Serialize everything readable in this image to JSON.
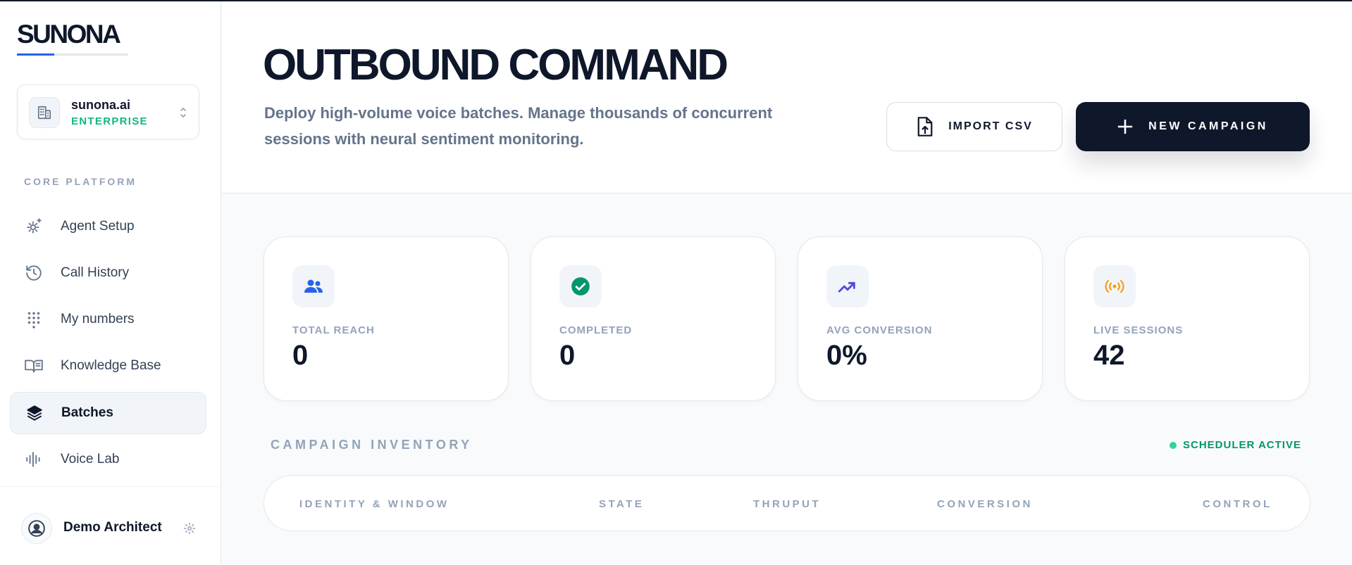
{
  "brand": {
    "name": "SUNONA"
  },
  "org": {
    "name": "sunona.ai",
    "plan": "ENTERPRISE"
  },
  "sidebar": {
    "section_title": "CORE PLATFORM",
    "items": [
      {
        "label": "Agent Setup",
        "icon": "gear-sparkle-icon"
      },
      {
        "label": "Call History",
        "icon": "history-icon"
      },
      {
        "label": "My numbers",
        "icon": "dialpad-icon"
      },
      {
        "label": "Knowledge Base",
        "icon": "book-open-icon"
      },
      {
        "label": "Batches",
        "icon": "layers-icon",
        "active": true
      },
      {
        "label": "Voice Lab",
        "icon": "audio-waveform-icon"
      }
    ]
  },
  "user": {
    "name": "Demo Architect"
  },
  "header": {
    "title": "OUTBOUND COMMAND",
    "subtitle": "Deploy high-volume voice batches. Manage thousands of concurrent sessions with neural sentiment monitoring.",
    "import_label": "IMPORT CSV",
    "new_label": "NEW CAMPAIGN"
  },
  "stats": [
    {
      "label": "TOTAL REACH",
      "value": "0",
      "icon": "users-icon",
      "color": "#2563eb"
    },
    {
      "label": "COMPLETED",
      "value": "0",
      "icon": "check-circle-icon",
      "color": "#059669"
    },
    {
      "label": "AVG CONVERSION",
      "value": "0%",
      "icon": "trending-up-icon",
      "color": "#4f46e5"
    },
    {
      "label": "LIVE SESSIONS",
      "value": "42",
      "icon": "broadcast-icon",
      "color": "#f59e0b"
    }
  ],
  "inventory": {
    "title": "CAMPAIGN INVENTORY",
    "status": "SCHEDULER ACTIVE",
    "columns": [
      "IDENTITY & WINDOW",
      "STATE",
      "THRUPUT",
      "CONVERSION",
      "CONTROL"
    ]
  }
}
